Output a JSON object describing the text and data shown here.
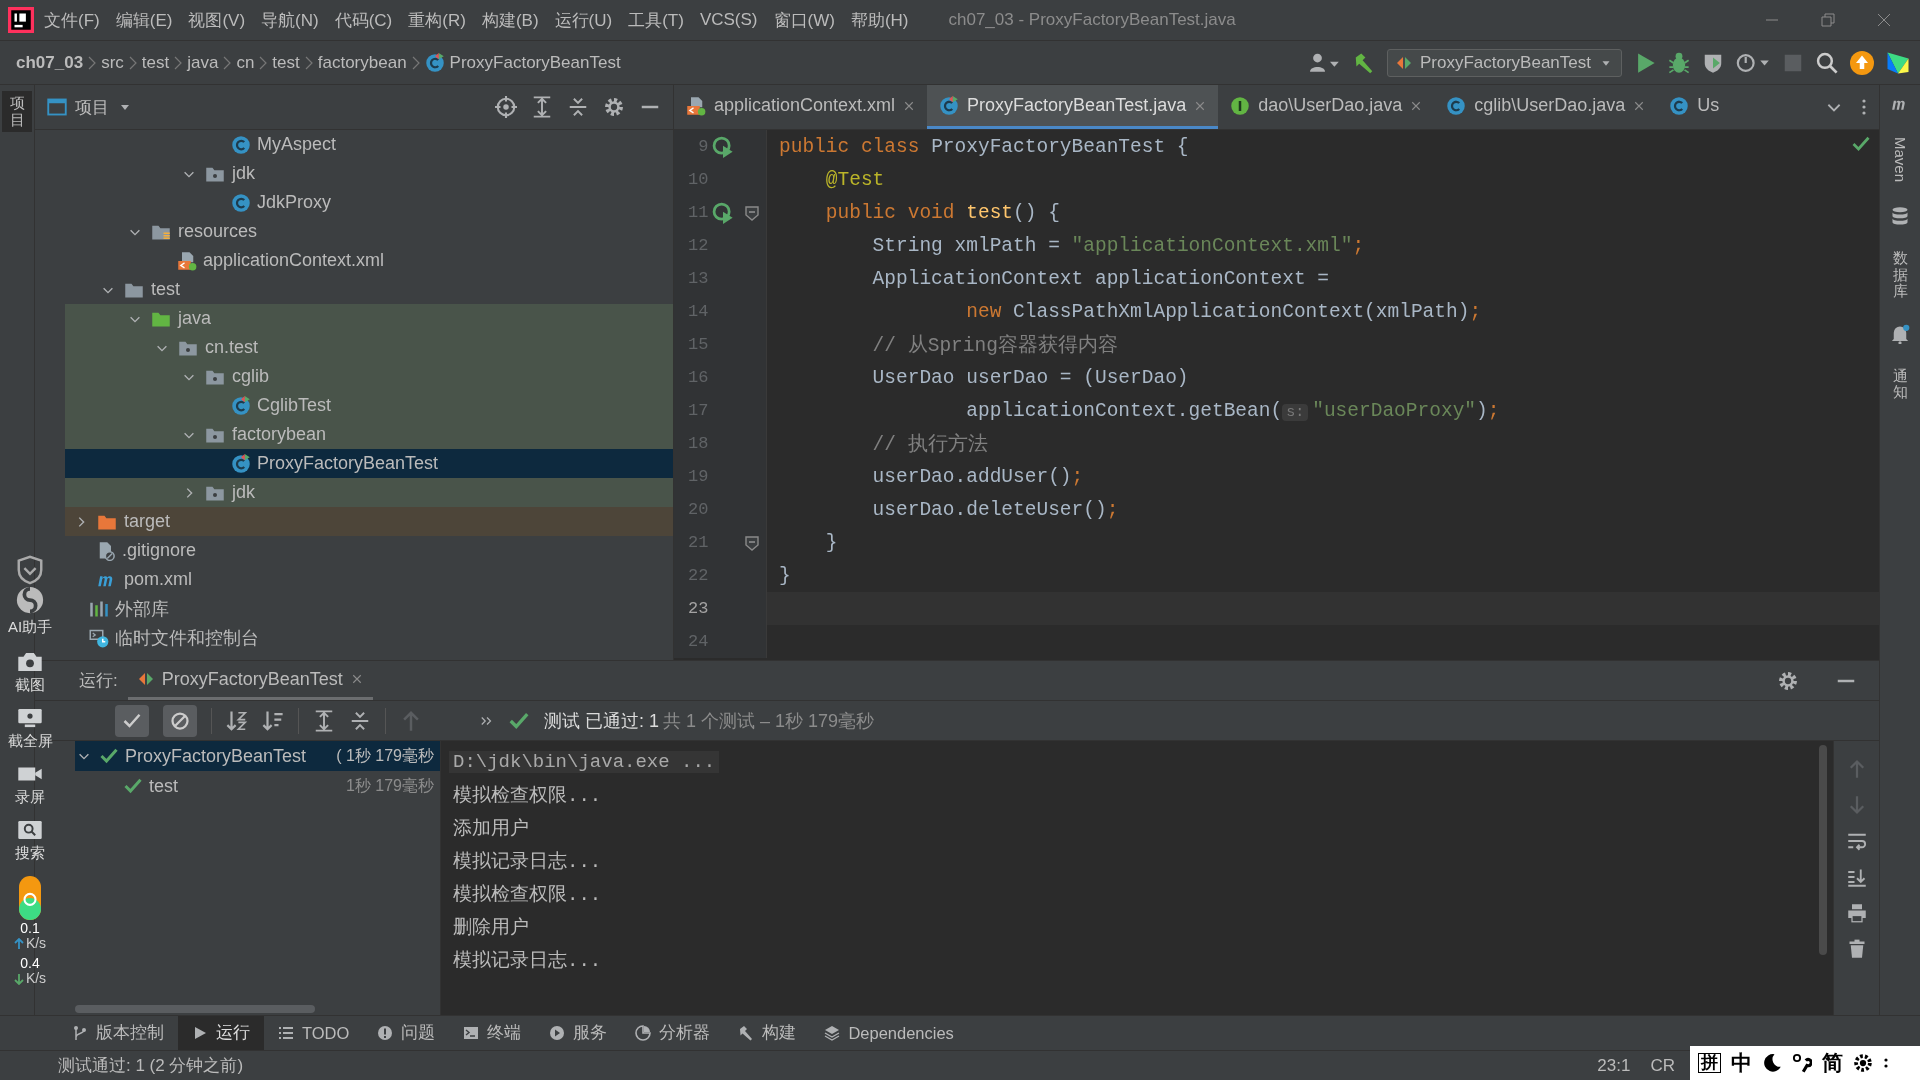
{
  "menu": [
    "文件(F)",
    "编辑(E)",
    "视图(V)",
    "导航(N)",
    "代码(C)",
    "重构(R)",
    "构建(B)",
    "运行(U)",
    "工具(T)",
    "VCS(S)",
    "窗口(W)",
    "帮助(H)"
  ],
  "window": {
    "title": "ch07_03 - ProxyFactoryBeanTest.java"
  },
  "breadcrumbs": [
    "ch07_03",
    "src",
    "test",
    "java",
    "cn",
    "test",
    "factorybean",
    "ProxyFactoryBeanTest"
  ],
  "run_config": {
    "label": "ProxyFactoryBeanTest"
  },
  "left_strip": {
    "project_tab": "项目"
  },
  "project_panel": {
    "title": "项目",
    "tree": [
      {
        "children": [
          {
            "children": [
              {
                "children": [
                  {
                    "children": [
                      {
                        "children": [
                          {
                            "children": [
                              {
                                "label": "MyAspect",
                                "kind": "class",
                                "selected": false
                              }
                            ]
                          },
                          {
                            "label": "jdk",
                            "kind": "package",
                            "expanded": true,
                            "selected": false,
                            "children": [
                              {
                                "label": "JdkProxy",
                                "kind": "class",
                                "selected": false
                              }
                            ]
                          }
                        ]
                      }
                    ]
                  },
                  {
                    "label": "resources",
                    "kind": "resources",
                    "expanded": true,
                    "selected": false,
                    "children": [
                      {
                        "label": "applicationContext.xml",
                        "kind": "xml",
                        "selected": false
                      }
                    ]
                  }
                ]
              },
              {
                "label": "test",
                "kind": "folder",
                "expanded": true,
                "selected": false,
                "children": [
                  {
                    "label": "java",
                    "kind": "test-root",
                    "expanded": true,
                    "selected": false,
                    "children": [
                      {
                        "label": "cn.test",
                        "kind": "package",
                        "expanded": true,
                        "selected": false,
                        "children": [
                          {
                            "label": "cglib",
                            "kind": "package",
                            "expanded": true,
                            "selected": false,
                            "children": [
                              {
                                "label": "CglibTest",
                                "kind": "test-class",
                                "selected": false
                              }
                            ]
                          },
                          {
                            "label": "factorybean",
                            "kind": "package",
                            "expanded": true,
                            "selected": false,
                            "children": [
                              {
                                "label": "ProxyFactoryBeanTest",
                                "kind": "test-class",
                                "selected": true
                              }
                            ]
                          },
                          {
                            "label": "jdk",
                            "kind": "package",
                            "expanded": false,
                            "selected": false
                          }
                        ]
                      }
                    ]
                  }
                ]
              }
            ]
          },
          {
            "label": "target",
            "kind": "excluded",
            "expanded": false,
            "selected": false
          },
          {
            "label": ".gitignore",
            "kind": "ignore",
            "selected": false
          },
          {
            "label": "pom.xml",
            "kind": "maven",
            "selected": false
          }
        ]
      },
      {
        "label": "外部库",
        "kind": "libraries",
        "selected": false
      },
      {
        "label": "临时文件和控制台",
        "kind": "scratches",
        "selected": false
      }
    ]
  },
  "ai_assistant": {
    "label": "AI助手"
  },
  "editor": {
    "tabs": [
      {
        "label": "applicationContext.xml",
        "kind": "xml",
        "selected": false,
        "closable": true
      },
      {
        "label": "ProxyFactoryBeanTest.java",
        "kind": "test-class",
        "selected": true,
        "closable": true
      },
      {
        "label": "dao\\UserDao.java",
        "kind": "interface",
        "selected": false,
        "closable": true
      },
      {
        "label": "cglib\\UserDao.java",
        "kind": "class",
        "selected": false,
        "closable": true
      },
      {
        "label": "Us",
        "kind": "class",
        "selected": false,
        "closable": false
      }
    ],
    "lines": [
      {
        "number": "9",
        "run": true,
        "fold": false,
        "current": false,
        "tokens": [
          {
            "kind": "kw",
            "text": "public class "
          },
          {
            "kind": "plain",
            "text": "ProxyFactoryBeanTest {"
          }
        ]
      },
      {
        "number": "10",
        "run": false,
        "fold": false,
        "current": false,
        "tokens": [
          {
            "kind": "ann",
            "text": "    @Test"
          }
        ]
      },
      {
        "number": "11",
        "run": true,
        "fold": true,
        "current": false,
        "tokens": [
          {
            "kind": "kw",
            "text": "    public void "
          },
          {
            "kind": "fn",
            "text": "test"
          },
          {
            "kind": "plain",
            "text": "() {"
          }
        ]
      },
      {
        "number": "12",
        "run": false,
        "fold": false,
        "current": false,
        "tokens": [
          {
            "kind": "plain",
            "text": "        String xmlPath = "
          },
          {
            "kind": "str",
            "text": "\"applicationContext.xml\""
          },
          {
            "kind": "kw",
            "text": ";"
          }
        ]
      },
      {
        "number": "13",
        "run": false,
        "fold": false,
        "current": false,
        "tokens": [
          {
            "kind": "plain",
            "text": "        ApplicationContext applicationContext ="
          }
        ]
      },
      {
        "number": "14",
        "run": false,
        "fold": false,
        "current": false,
        "tokens": [
          {
            "kind": "kw",
            "text": "                new "
          },
          {
            "kind": "plain",
            "text": "ClassPathXmlApplicationContext(xmlPath)"
          },
          {
            "kind": "kw",
            "text": ";"
          }
        ]
      },
      {
        "number": "15",
        "run": false,
        "fold": false,
        "current": false,
        "tokens": [
          {
            "kind": "cmt",
            "text": "        // 从Spring容器获得内容"
          }
        ]
      },
      {
        "number": "16",
        "run": false,
        "fold": false,
        "current": false,
        "tokens": [
          {
            "kind": "plain",
            "text": "        UserDao userDao = (UserDao)"
          }
        ]
      },
      {
        "number": "17",
        "run": false,
        "fold": false,
        "current": false,
        "tokens": [
          {
            "kind": "plain",
            "text": "                applicationContext.getBean("
          },
          {
            "kind": "hint",
            "text": "s:"
          },
          {
            "kind": "str",
            "text": "\"userDaoProxy\""
          },
          {
            "kind": "plain",
            "text": ")"
          },
          {
            "kind": "kw",
            "text": ";"
          }
        ]
      },
      {
        "number": "18",
        "run": false,
        "fold": false,
        "current": false,
        "tokens": [
          {
            "kind": "cmt",
            "text": "        // 执行方法"
          }
        ]
      },
      {
        "number": "19",
        "run": false,
        "fold": false,
        "current": false,
        "tokens": [
          {
            "kind": "plain",
            "text": "        userDao.addUser()"
          },
          {
            "kind": "kw",
            "text": ";"
          }
        ]
      },
      {
        "number": "20",
        "run": false,
        "fold": false,
        "current": false,
        "tokens": [
          {
            "kind": "plain",
            "text": "        userDao.deleteUser()"
          },
          {
            "kind": "kw",
            "text": ";"
          }
        ]
      },
      {
        "number": "21",
        "run": false,
        "fold": true,
        "current": false,
        "tokens": [
          {
            "kind": "plain",
            "text": "    }"
          }
        ]
      },
      {
        "number": "22",
        "run": false,
        "fold": false,
        "current": false,
        "tokens": [
          {
            "kind": "plain",
            "text": "}"
          }
        ]
      },
      {
        "number": "23",
        "run": false,
        "fold": false,
        "current": true
      },
      {
        "number": "24",
        "run": false,
        "fold": false,
        "current": false
      }
    ]
  },
  "right_strip": [
    "Maven",
    "数据库",
    "通知"
  ],
  "run_panel": {
    "label": "运行:",
    "tab": "ProxyFactoryBeanTest",
    "toggles": [
      {
        "kind": "passed",
        "selected": true
      },
      {
        "kind": "ignored",
        "selected": true
      }
    ],
    "status_passed": "测试 已通过: 1",
    "status_detail": "共 1 个测试 – 1秒 179毫秒",
    "tests": [
      {
        "label": "ProxyFactoryBeanTest",
        "time": "( 1秒 179毫秒",
        "selected": true,
        "expanded": true,
        "children": [
          {
            "label": "test",
            "time": "1秒 179毫秒",
            "selected": false
          }
        ]
      }
    ],
    "console": [
      {
        "kind": "command",
        "text": "D:\\jdk\\bin\\java.exe ..."
      },
      {
        "kind": "output",
        "text": "模拟检查权限..."
      },
      {
        "kind": "output",
        "text": "添加用户"
      },
      {
        "kind": "output",
        "text": "模拟记录日志..."
      },
      {
        "kind": "output",
        "text": "模拟检查权限..."
      },
      {
        "kind": "output",
        "text": "删除用户"
      },
      {
        "kind": "output",
        "text": "模拟记录日志..."
      }
    ]
  },
  "float_toolbar": {
    "items": [
      {
        "kind": "camera",
        "label": "截图"
      },
      {
        "kind": "screen",
        "label": "截全屏"
      },
      {
        "kind": "video",
        "label": "录屏"
      },
      {
        "kind": "search",
        "label": "搜索"
      }
    ],
    "speeds": [
      {
        "kind": "up",
        "value": "0.1",
        "unit": "K/s"
      },
      {
        "kind": "down",
        "value": "0.4",
        "unit": "K/s"
      }
    ]
  },
  "tool_tabs": [
    {
      "kind": "vcs",
      "label": "版本控制",
      "selected": false
    },
    {
      "kind": "run",
      "label": "运行",
      "selected": true
    },
    {
      "kind": "todo",
      "label": "TODO",
      "selected": false
    },
    {
      "kind": "problems",
      "label": "问题",
      "selected": false
    },
    {
      "kind": "terminal",
      "label": "终端",
      "selected": false
    },
    {
      "kind": "services",
      "label": "服务",
      "selected": false
    },
    {
      "kind": "profiler",
      "label": "分析器",
      "selected": false
    },
    {
      "kind": "build",
      "label": "构建",
      "selected": false
    },
    {
      "kind": "deps",
      "label": "Dependencies",
      "selected": false
    }
  ],
  "status_bar": {
    "message": "测试通过: 1 (2 分钟之前)",
    "position": "23:1",
    "line_sep": "CR"
  },
  "ime_bar": {
    "mode": "拼",
    "language": "中",
    "script": "简"
  }
}
